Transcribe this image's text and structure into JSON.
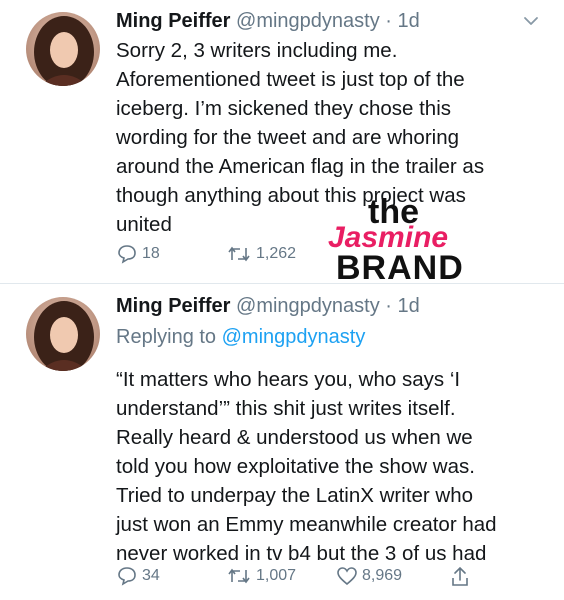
{
  "tweets": [
    {
      "name": "Ming Peiffer",
      "handle": "@mingpdynasty",
      "time": "· 1d",
      "body_lines": [
        "Sorry 2, 3 writers including me.",
        "Aforementioned tweet is just top of the",
        "iceberg. I’m sickened they chose this",
        "wording for the tweet and are whoring",
        "around the American flag in the trailer as",
        "though anything about this project was",
        "united"
      ],
      "replies": "18",
      "retweets": "1,262"
    },
    {
      "name": "Ming Peiffer",
      "handle": "@mingpdynasty",
      "time": "· 1d",
      "reply_prefix": "Replying to",
      "reply_to": "@mingpdynasty",
      "body_lines": [
        "“It matters who hears you, who says ‘I",
        "understand’” this shit just writes itself.",
        "Really heard & understood us when we",
        "told you how exploitative the show was.",
        "Tried to underpay the LatinX writer who",
        "just won an Emmy meanwhile creator had",
        "never worked in tv b4 but the 3 of us had"
      ],
      "replies": "34",
      "retweets": "1,007",
      "likes": "8,969"
    }
  ],
  "watermark": {
    "line1": "the",
    "line2": "Jasmine",
    "line3": "BRAND"
  },
  "colors": {
    "text": "#14171a",
    "secondary": "#657786",
    "link": "#1da1f2",
    "divider": "#e1e8ed",
    "brand_pink": "#e91e63"
  },
  "icons": [
    "reply-icon",
    "retweet-icon",
    "like-icon",
    "share-icon",
    "chevron-down-icon"
  ]
}
